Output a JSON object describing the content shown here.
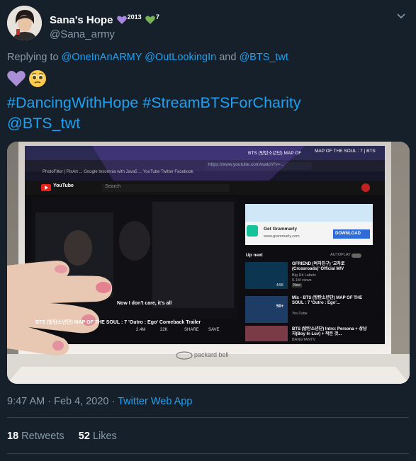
{
  "tweet": {
    "display_name": "Sana's Hope",
    "badge_2013": "2013",
    "badge_7": "7",
    "handle": "@Sana_army",
    "replying_prefix": "Replying to",
    "reply_1": "@OneInAnARMY",
    "reply_2": "@OutLookingIn",
    "reply_and": "and",
    "reply_3": "@BTS_twt",
    "hashtag_1": "#DancingWithHope",
    "hashtag_2": "#StreamBTSForCharity",
    "mention": "@BTS_twt",
    "time": "9:47 AM",
    "date": "Feb 4, 2020",
    "source": "Twitter Web App",
    "retweets_count": "18",
    "retweets_label": "Retweets",
    "likes_count": "52",
    "likes_label": "Likes"
  },
  "photo": {
    "tab_1": "BTS (방탄소년단) MAP OF",
    "tab_2": "MAP OF THE SOUL : 7 | BTS",
    "address": "https://www.youtube.com/watch?v=...",
    "bookmarks": "PhotoFilter | PixArt ...   Google   Insomnia with Java5 ...   YouTube   Twitter   Facebook",
    "yt_logo": "YouTube",
    "search_placeholder": "Search",
    "ad_title": "Get Grammarly",
    "ad_url": "www.grammarly.com",
    "ad_button": "DOWNLOAD",
    "up_next": "Up next",
    "autoplay": "AUTOPLAY",
    "rec_1_title": "GFRIEND (여자친구) '교차로 (Crossroads)' Official M/V",
    "rec_1_channel": "Big Hit Labels",
    "rec_1_views": "6.1M views",
    "rec_1_duration": "4:56",
    "rec_1_badge": "New",
    "rec_2_title": "Mix - BTS (방탄소년단) MAP OF THE SOUL : 7 'Outro : Ego'...",
    "rec_2_channel": "YouTube",
    "rec_2_count": "50+",
    "rec_3_title": "BTS (방탄소년단) Intro: Persona + 상남자(Boy In Luv) + 작은 것...",
    "rec_3_channel": "BANGTANTV",
    "subtitle": "Now I don't care, it's all",
    "video_title": "BTS (방탄소년단) MAP OF THE SOUL : 7 'Outro : Ego' Comeback Trailer",
    "likes": "2.4M",
    "dislikes": "22K",
    "share": "SHARE",
    "save": "SAVE",
    "laptop_brand": "packard bell"
  },
  "colors": {
    "background": "#15202b",
    "accent": "#1da1f2",
    "muted": "#8899a6",
    "divider": "#38444d"
  }
}
